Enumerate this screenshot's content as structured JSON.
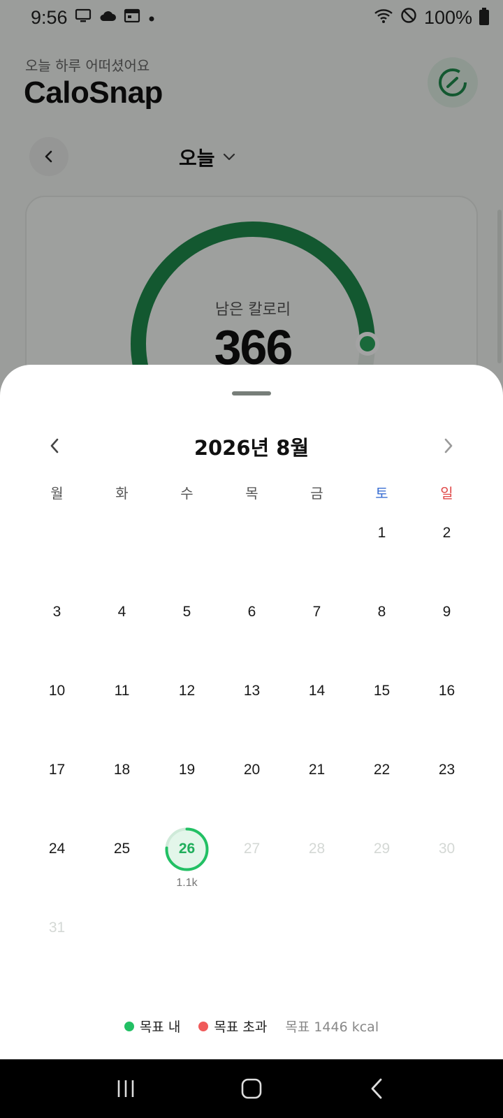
{
  "status_bar": {
    "time": "9:56",
    "battery": "100%",
    "icons": [
      "monitor-icon",
      "cloud-icon",
      "calendar-icon",
      "dot-icon",
      "wifi-icon",
      "do-not-disturb-icon",
      "battery-icon"
    ]
  },
  "header": {
    "greeting": "오늘 하루 어떠셨어요",
    "title": "CaloSnap"
  },
  "date_nav": {
    "current_label": "오늘"
  },
  "summary": {
    "remaining_label": "남은 칼로리",
    "remaining_value": "366",
    "ring_progress": 0.75
  },
  "calendar": {
    "month_title": "2026년 8월",
    "weekdays": [
      "월",
      "화",
      "수",
      "목",
      "금",
      "토",
      "일"
    ],
    "weeks": [
      [
        {
          "d": ""
        },
        {
          "d": ""
        },
        {
          "d": ""
        },
        {
          "d": ""
        },
        {
          "d": ""
        },
        {
          "d": "1"
        },
        {
          "d": "2"
        }
      ],
      [
        {
          "d": "3"
        },
        {
          "d": "4"
        },
        {
          "d": "5"
        },
        {
          "d": "6"
        },
        {
          "d": "7"
        },
        {
          "d": "8"
        },
        {
          "d": "9"
        }
      ],
      [
        {
          "d": "10"
        },
        {
          "d": "11"
        },
        {
          "d": "12"
        },
        {
          "d": "13"
        },
        {
          "d": "14"
        },
        {
          "d": "15"
        },
        {
          "d": "16"
        }
      ],
      [
        {
          "d": "17"
        },
        {
          "d": "18"
        },
        {
          "d": "19"
        },
        {
          "d": "20"
        },
        {
          "d": "21"
        },
        {
          "d": "22"
        },
        {
          "d": "23"
        }
      ],
      [
        {
          "d": "24"
        },
        {
          "d": "25"
        },
        {
          "d": "26",
          "today": true,
          "kcal": "1.1k",
          "progress": 0.76
        },
        {
          "d": "27",
          "future": true
        },
        {
          "d": "28",
          "future": true
        },
        {
          "d": "29",
          "future": true
        },
        {
          "d": "30",
          "future": true
        }
      ],
      [
        {
          "d": "31",
          "future": true
        },
        {
          "d": ""
        },
        {
          "d": ""
        },
        {
          "d": ""
        },
        {
          "d": ""
        },
        {
          "d": ""
        },
        {
          "d": ""
        }
      ]
    ]
  },
  "legend": {
    "within_goal": "목표 내",
    "over_goal": "목표 초과",
    "goal_text": "목표 1446 kcal"
  },
  "colors": {
    "within": "#22c064",
    "over": "#f05a5a",
    "ring": "#1f8a4c",
    "today_bg": "#e3f6ea",
    "saturday": "#3b6fd3",
    "sunday": "#e04848"
  }
}
